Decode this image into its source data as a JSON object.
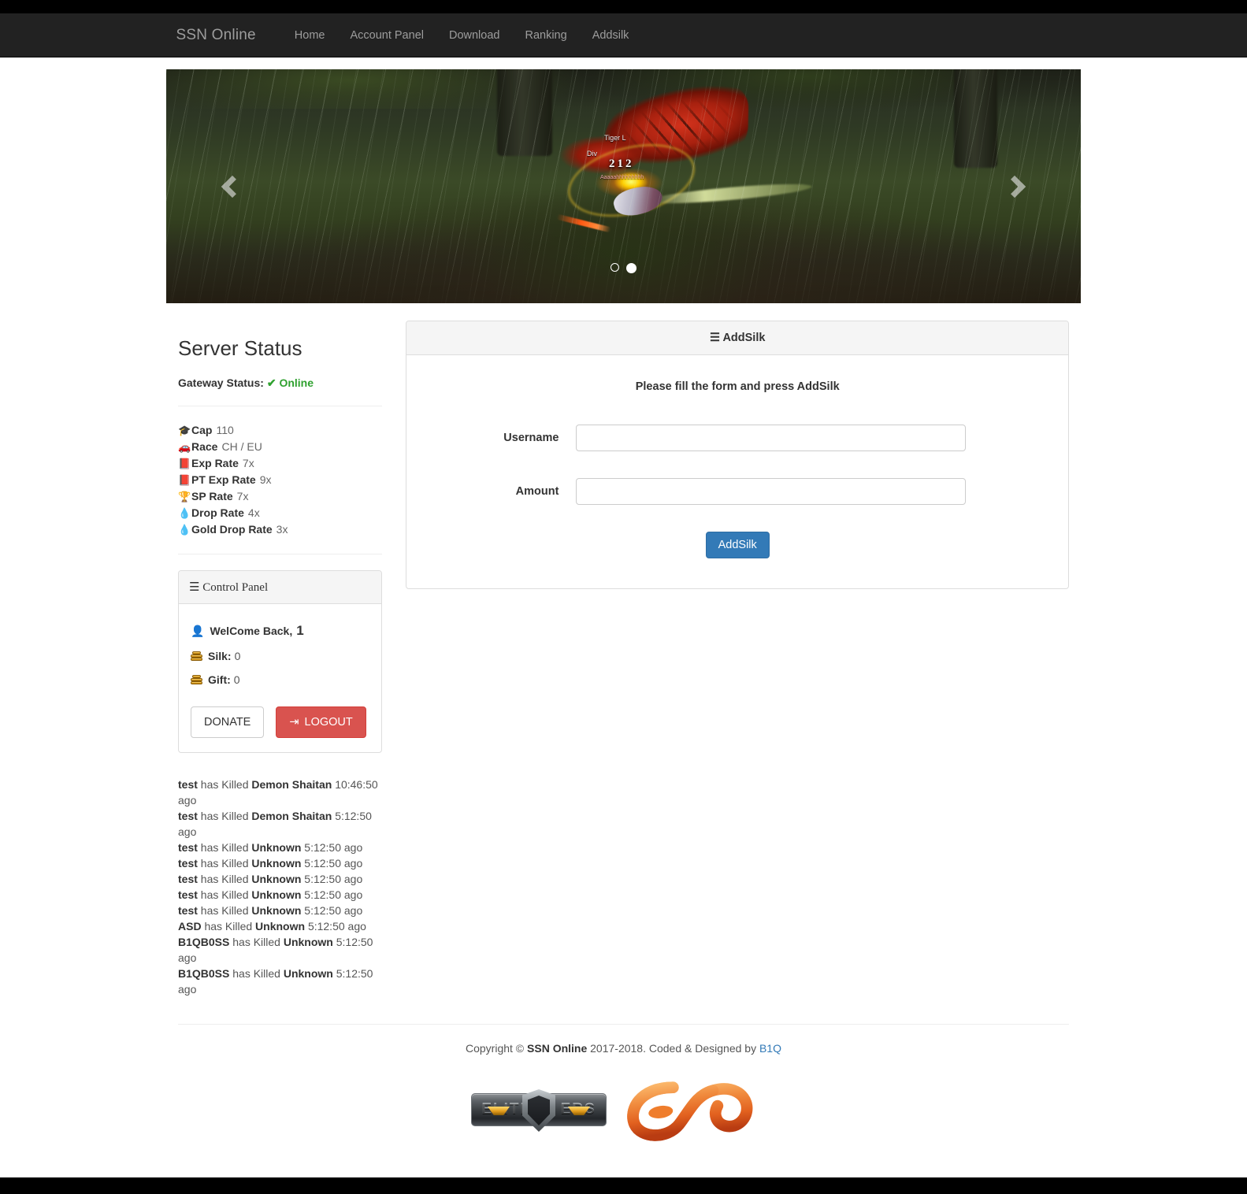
{
  "navbar": {
    "brand": "SSN Online",
    "links": [
      {
        "label": "Home",
        "name": "nav-home"
      },
      {
        "label": "Account Panel",
        "name": "nav-account-panel"
      },
      {
        "label": "Download",
        "name": "nav-download"
      },
      {
        "label": "Ranking",
        "name": "nav-ranking"
      },
      {
        "label": "Addsilk",
        "name": "nav-addsilk"
      }
    ]
  },
  "carousel": {
    "slide_labels": {
      "target_name": "Tiger L",
      "secondary_name": "Div",
      "damage": "212",
      "chat": "Aaaaahhhhhhhhh"
    },
    "prev_label": "Previous",
    "next_label": "Next",
    "indicator_count": 2,
    "active_indicator": 1
  },
  "server_status": {
    "title": "Server Status",
    "gateway_label": "Gateway Status:",
    "gateway_value": "Online",
    "gateway_color": "#2fa12f",
    "stats": [
      {
        "icon": "graduation-cap-icon",
        "glyph": "🎓",
        "label": "Cap",
        "value": "110"
      },
      {
        "icon": "car-icon",
        "glyph": "🚗",
        "label": "Race",
        "value": "CH / EU"
      },
      {
        "icon": "book-icon",
        "glyph": "📕",
        "label": "Exp Rate",
        "value": "7x"
      },
      {
        "icon": "book-icon",
        "glyph": "📕",
        "label": "PT Exp Rate",
        "value": "9x"
      },
      {
        "icon": "trophy-icon",
        "glyph": "🏆",
        "label": "SP Rate",
        "value": "7x"
      },
      {
        "icon": "tint-icon",
        "glyph": "💧",
        "label": "Drop Rate",
        "value": "4x"
      },
      {
        "icon": "tint-icon",
        "glyph": "💧",
        "label": "Gold Drop Rate",
        "value": "3x"
      }
    ]
  },
  "control_panel": {
    "title": "Control Panel",
    "welcome_label": "WelCome Back,",
    "welcome_user": "1",
    "silk_label": "Silk:",
    "silk_value": "0",
    "gift_label": "Gift:",
    "gift_value": "0",
    "donate_label": "DONATE",
    "logout_label": "LOGOUT"
  },
  "addsilk_panel": {
    "title": "AddSilk",
    "intro": "Please fill the form and press AddSilk",
    "fields": [
      {
        "label": "Username",
        "value": "",
        "placeholder": "",
        "name": "username-input"
      },
      {
        "label": "Amount",
        "value": "",
        "placeholder": "",
        "name": "amount-input"
      }
    ],
    "submit_label": "AddSilk",
    "submit_color": "#337ab7"
  },
  "kill_log": [
    {
      "player": "test",
      "verb": "has Killed",
      "target": "Demon Shaitan",
      "time": "10:46:50 ago"
    },
    {
      "player": "test",
      "verb": "has Killed",
      "target": "Demon Shaitan",
      "time": "5:12:50 ago"
    },
    {
      "player": "test",
      "verb": "has Killed",
      "target": "Unknown",
      "time": "5:12:50 ago"
    },
    {
      "player": "test",
      "verb": "has Killed",
      "target": "Unknown",
      "time": "5:12:50 ago"
    },
    {
      "player": "test",
      "verb": "has Killed",
      "target": "Unknown",
      "time": "5:12:50 ago"
    },
    {
      "player": "test",
      "verb": "has Killed",
      "target": "Unknown",
      "time": "5:12:50 ago"
    },
    {
      "player": "test",
      "verb": "has Killed",
      "target": "Unknown",
      "time": "5:12:50 ago"
    },
    {
      "player": "ASD",
      "verb": "has Killed",
      "target": "Unknown",
      "time": "5:12:50 ago"
    },
    {
      "player": "B1QB0SS",
      "verb": "has Killed",
      "target": "Unknown",
      "time": "5:12:50 ago"
    },
    {
      "player": "B1QB0SS",
      "verb": "has Killed",
      "target": "Unknown",
      "time": "5:12:50 ago"
    }
  ],
  "footer": {
    "copyright_prefix": "Copyright © ",
    "site_name": "SSN Online",
    "copyright_mid": " 2017-2018. Coded & Designed by ",
    "author": "B1Q",
    "logos": [
      {
        "name": "elitepvpers-logo",
        "text": "ELITE"
      },
      {
        "name": "elitepvpers-logo-suffix",
        "text": "ERS"
      },
      {
        "name": "alpha-infinity-logo",
        "text": ""
      }
    ]
  }
}
